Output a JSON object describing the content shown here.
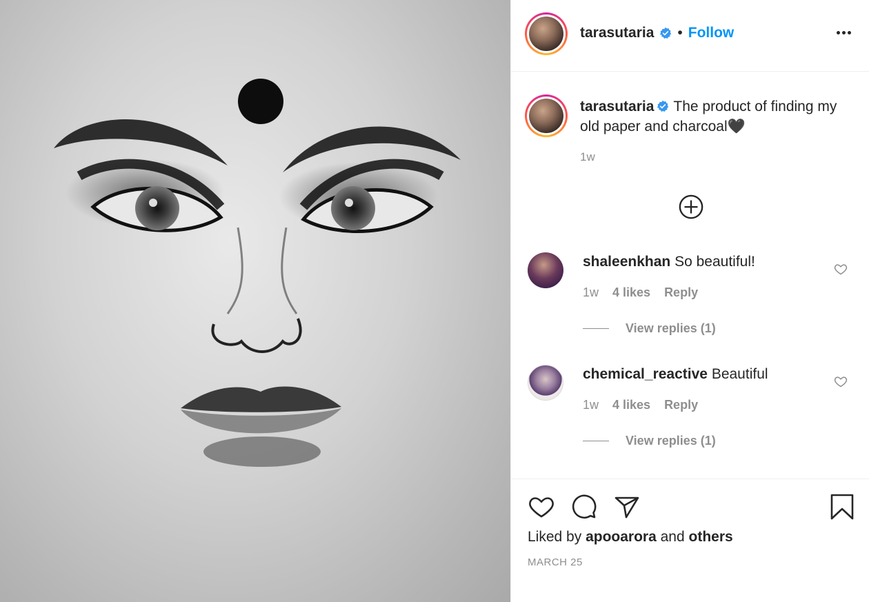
{
  "header": {
    "username": "tarasutaria",
    "separator": "•",
    "follow_label": "Follow"
  },
  "caption": {
    "username": "tarasutaria",
    "text": "The product of finding my old paper and charcoal🖤",
    "time": "1w"
  },
  "comments": [
    {
      "username": "shaleenkhan",
      "text": "So beautiful!",
      "time": "1w",
      "likes": "4 likes",
      "reply_label": "Reply",
      "view_replies": "View replies (1)"
    },
    {
      "username": "chemical_reactive",
      "text": "Beautiful",
      "time": "1w",
      "likes": "4 likes",
      "reply_label": "Reply",
      "view_replies": "View replies (1)"
    }
  ],
  "footer": {
    "liked_prefix": "Liked by",
    "liked_user": "apooarora",
    "liked_and": "and",
    "liked_others": "others",
    "date": "MARCH 25"
  },
  "colors": {
    "link_blue": "#0095f6",
    "verified_blue": "#3897f0",
    "muted": "#8e8e8e",
    "text": "#262626"
  }
}
